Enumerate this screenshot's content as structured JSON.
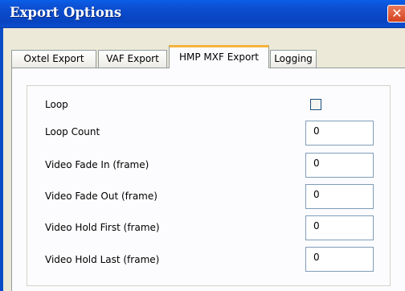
{
  "window": {
    "title": "Export Options",
    "close_label": "✕"
  },
  "tabs": [
    {
      "label": "Oxtel Export",
      "active": false
    },
    {
      "label": "VAF Export",
      "active": false
    },
    {
      "label": "HMP MXF Export",
      "active": true
    },
    {
      "label": "Logging",
      "active": false
    }
  ],
  "form": {
    "loop": {
      "label": "Loop",
      "checked": false
    },
    "loop_count": {
      "label": "Loop Count",
      "value": "0"
    },
    "fade_in": {
      "label": "Video Fade In (frame)",
      "value": "0"
    },
    "fade_out": {
      "label": "Video Fade Out (frame)",
      "value": "0"
    },
    "hold_first": {
      "label": "Video Hold First (frame)",
      "value": "0"
    },
    "hold_last": {
      "label": "Video Hold Last (frame)",
      "value": "0"
    }
  },
  "colors": {
    "titlebar": "#0a4cc6",
    "dialog_bg": "#ece9d8",
    "active_tab_accent": "#f4b43c",
    "close_button": "#d5421f"
  }
}
